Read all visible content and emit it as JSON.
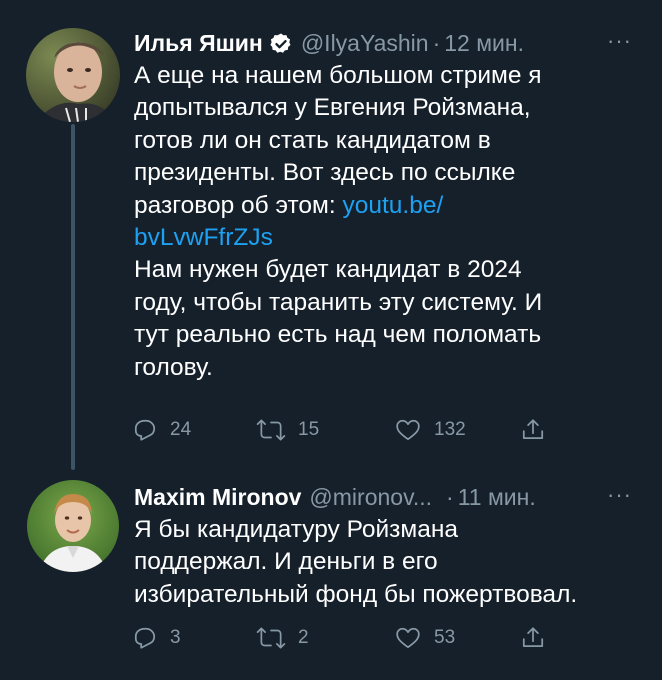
{
  "tweets": [
    {
      "display_name": "Илья Яшин",
      "verified": true,
      "handle": "@IlyaYashin",
      "separator": "·",
      "time": "12 мин.",
      "more": "···",
      "lines": [
        "А еще на нашем большом стриме я",
        "допытывался у Евгения Ройзмана,",
        "готов ли он стать кандидатом в",
        "президенты. Вот здесь по ссылке",
        "разговор об этом: ",
        "bvLvwFfrZJs",
        "Нам нужен будет кандидат в 2024",
        "году, чтобы таранить эту систему. И",
        "тут реально есть над чем поломать",
        "голову."
      ],
      "link_part1": "youtu.be/",
      "reply_count": "24",
      "retweet_count": "15",
      "like_count": "132",
      "avatar_icon": "user-avatar-photo",
      "colors": {
        "link": "#1da1f2",
        "muted": "#8899a6",
        "background": "#15202b"
      }
    },
    {
      "display_name": "Maxim Mironov",
      "handle": "@mironov...",
      "separator": "·",
      "time": "11 мин.",
      "more": "···",
      "lines": [
        "Я бы кандидатуру Ройзмана",
        "поддержал. И деньги в его",
        "избирательный фонд бы пожертвовал."
      ],
      "reply_count": "3",
      "retweet_count": "2",
      "like_count": "53",
      "avatar_icon": "user-avatar-photo"
    }
  ]
}
